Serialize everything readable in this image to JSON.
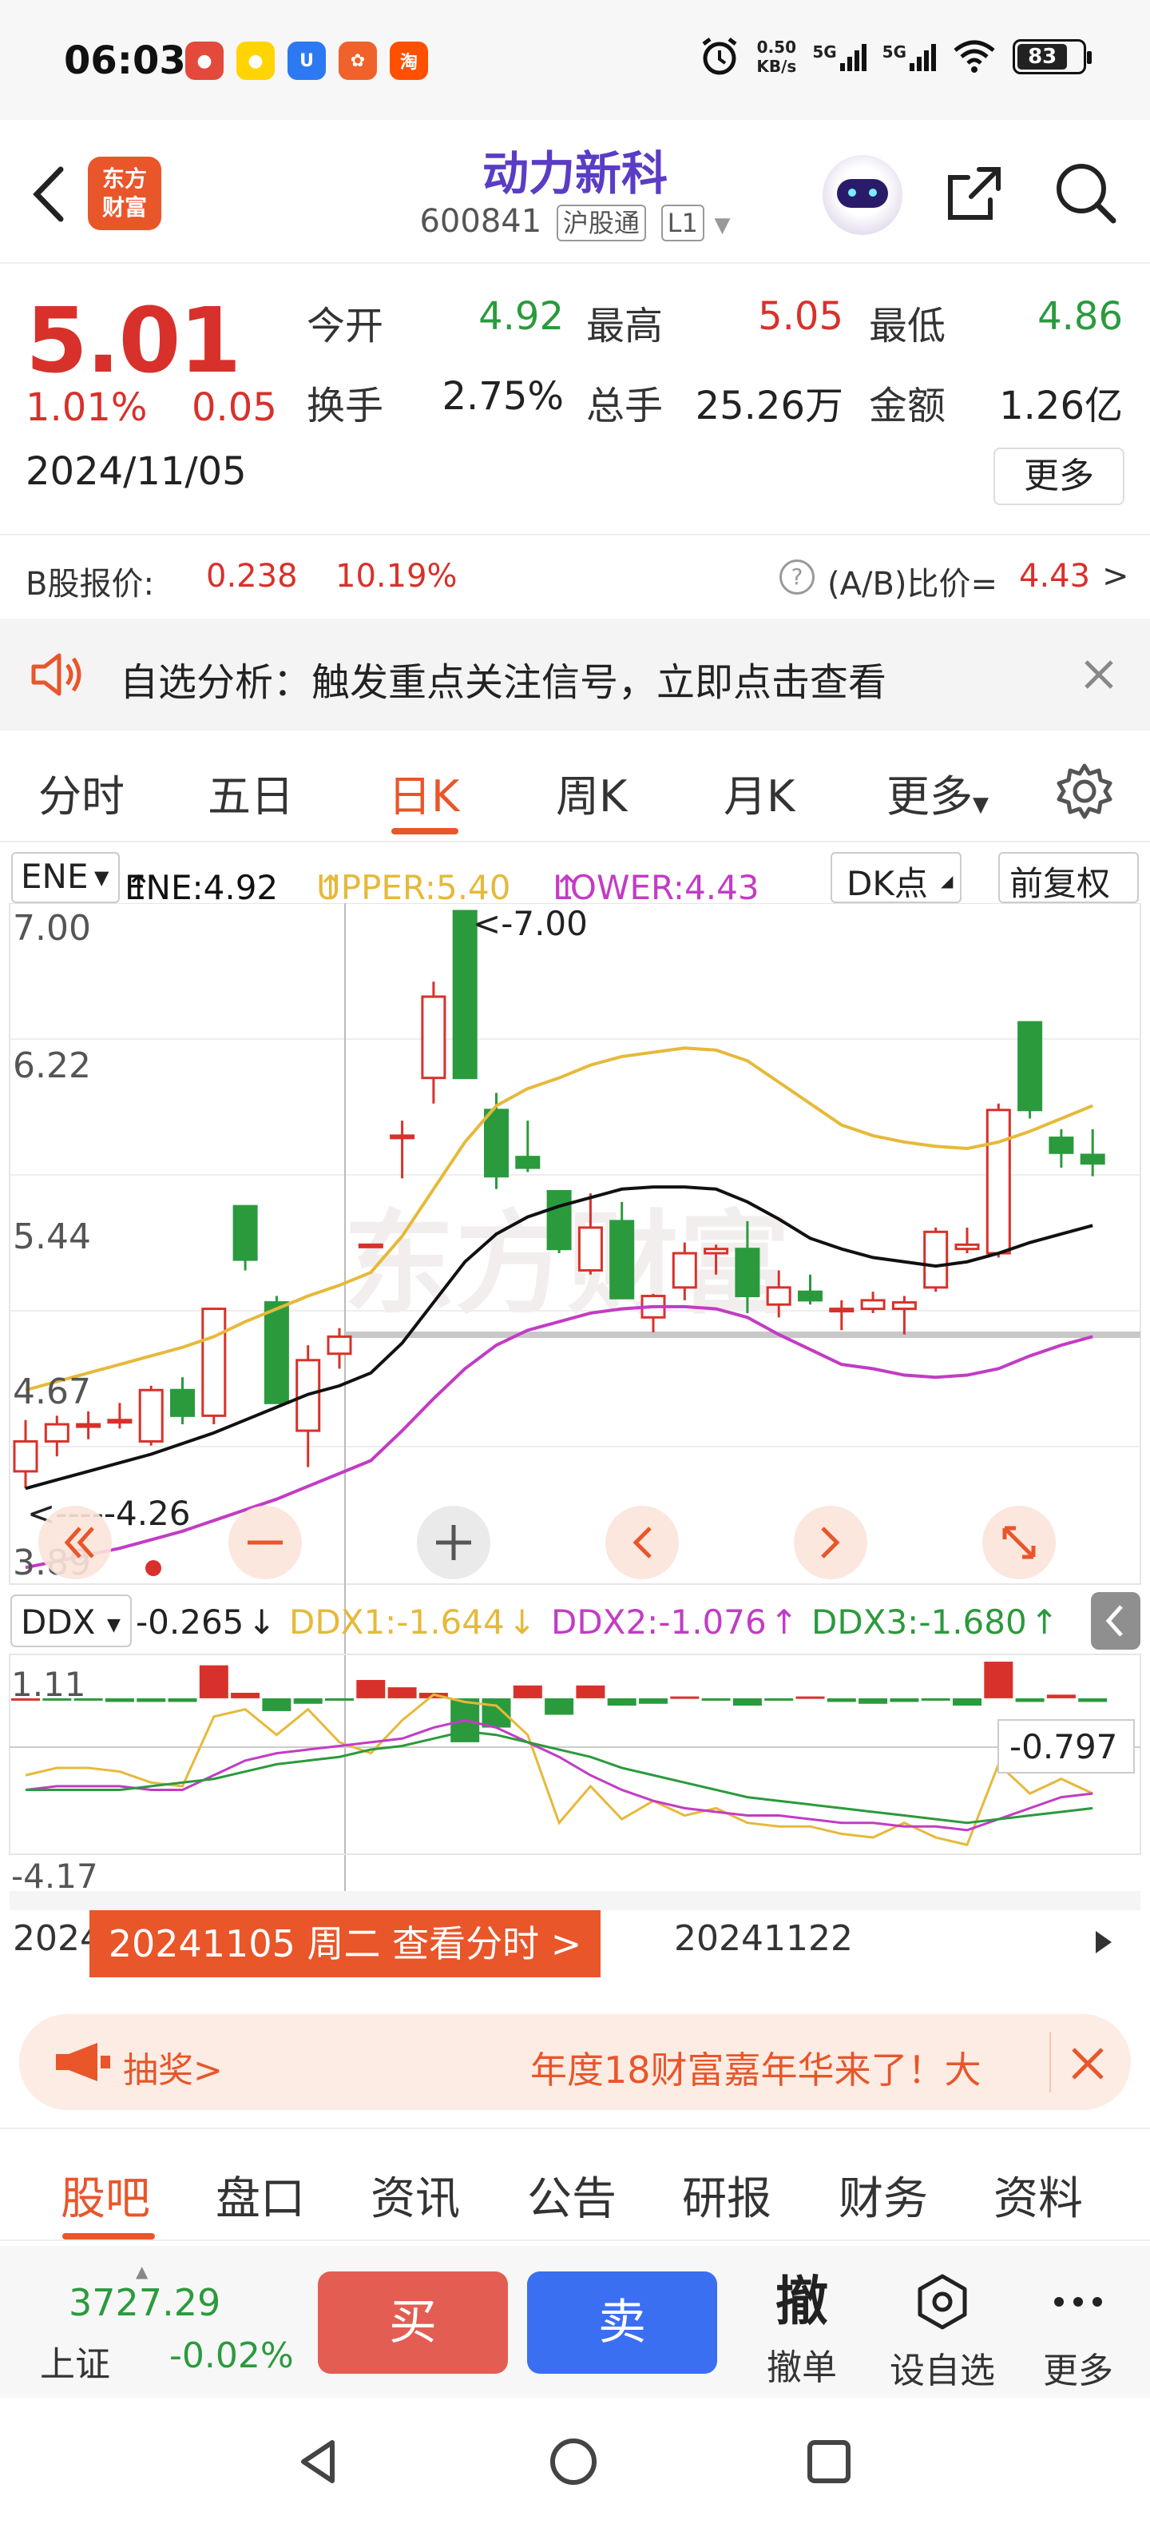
{
  "status_bar": {
    "time": "06:03",
    "app_icons": [
      "app-icon-1",
      "app-icon-2",
      "app-icon-3",
      "app-icon-4",
      "app-icon-5"
    ],
    "net_speed_value": "0.50",
    "net_speed_unit": "KB/s",
    "net_type_1": "5G",
    "net_type_2": "5G",
    "battery": "83"
  },
  "header": {
    "logo_line1": "东方",
    "logo_line2": "财富",
    "stock_name": "动力新科",
    "stock_code": "600841",
    "tag_connect": "沪股通",
    "tag_level": "L1"
  },
  "quote": {
    "price": "5.01",
    "change_pct": "1.01%",
    "change_val": "0.05",
    "date": "2024/11/05",
    "open_label": "今开",
    "open": "4.92",
    "high_label": "最高",
    "high": "5.05",
    "low_label": "最低",
    "low": "4.86",
    "turnover_label": "换手",
    "turnover": "2.75%",
    "volume_label": "总手",
    "volume": "25.26万",
    "amount_label": "金额",
    "amount": "1.26亿",
    "more_label": "更多"
  },
  "bshare": {
    "label": "B股报价:",
    "price": "0.238",
    "pct": "10.19%",
    "ratio_label": "(A/B)比价=",
    "ratio": "4.43",
    "arrow": ">"
  },
  "alert": {
    "text": "自选分析：触发重点关注信号，立即点击查看"
  },
  "chart_tabs": {
    "items": [
      "分时",
      "五日",
      "日K",
      "周K",
      "月K",
      "更多"
    ],
    "active": "日K"
  },
  "indicator": {
    "name": "ENE",
    "ene": "ENE:4.92",
    "ene_arrow": "↑",
    "upper": "UPPER:5.40",
    "upper_arrow": "↑",
    "lower": "LOWER:4.43",
    "lower_arrow": "↑",
    "dk_label": "DK点",
    "adjust_label": "前复权",
    "ddx_name": "DDX",
    "ddx": "-0.265",
    "ddx_arrow": "↓",
    "ddx1": "DDX1:-1.644",
    "ddx1_arrow": "↓",
    "ddx2": "DDX2:-1.076",
    "ddx2_arrow": "↑",
    "ddx3": "DDX3:-1.680",
    "ddx3_arrow": "↑"
  },
  "chart_labels": {
    "y_ticks": [
      "7.00",
      "6.22",
      "5.44",
      "4.67",
      "3.89"
    ],
    "max_marker": "<-7.00",
    "min_marker": "<-----4.26",
    "ddx_y_top": "1.11",
    "ddx_y_bottom": "-4.17",
    "ddx_current": "-0.797",
    "date_axis_left": "2024",
    "date_axis_mid": "20241122"
  },
  "chart_data": {
    "type": "candlestick",
    "ylim": [
      3.89,
      7.0
    ],
    "colors": {
      "up": "#d8312b",
      "down": "#2b9a3d",
      "upper": "#e6b93a",
      "mid": "#111111",
      "lower": "#c23cc4"
    },
    "candles": [
      {
        "o": 4.38,
        "h": 4.62,
        "l": 4.3,
        "c": 4.52
      },
      {
        "o": 4.52,
        "h": 4.64,
        "l": 4.45,
        "c": 4.6
      },
      {
        "o": 4.6,
        "h": 4.66,
        "l": 4.53,
        "c": 4.6
      },
      {
        "o": 4.62,
        "h": 4.7,
        "l": 4.58,
        "c": 4.62
      },
      {
        "o": 4.52,
        "h": 4.78,
        "l": 4.5,
        "c": 4.76
      },
      {
        "o": 4.76,
        "h": 4.82,
        "l": 4.6,
        "c": 4.64
      },
      {
        "o": 4.64,
        "h": 5.14,
        "l": 4.6,
        "c": 5.14
      },
      {
        "o": 5.62,
        "h": 5.62,
        "l": 5.32,
        "c": 5.37
      },
      {
        "o": 5.17,
        "h": 5.2,
        "l": 4.7,
        "c": 4.7
      },
      {
        "o": 4.57,
        "h": 4.97,
        "l": 4.4,
        "c": 4.9
      },
      {
        "o": 4.93,
        "h": 5.05,
        "l": 4.86,
        "c": 5.01
      },
      {
        "o": 5.44,
        "h": 5.44,
        "l": 5.44,
        "c": 5.44
      },
      {
        "o": 5.95,
        "h": 6.02,
        "l": 5.75,
        "c": 5.95
      },
      {
        "o": 6.22,
        "h": 6.67,
        "l": 6.1,
        "c": 6.6
      },
      {
        "o": 7.0,
        "h": 7.0,
        "l": 6.22,
        "c": 6.22
      },
      {
        "o": 6.07,
        "h": 6.15,
        "l": 5.7,
        "c": 5.76
      },
      {
        "o": 5.85,
        "h": 6.02,
        "l": 5.78,
        "c": 5.8
      },
      {
        "o": 5.69,
        "h": 5.69,
        "l": 5.4,
        "c": 5.42
      },
      {
        "o": 5.32,
        "h": 5.68,
        "l": 5.3,
        "c": 5.52
      },
      {
        "o": 5.55,
        "h": 5.64,
        "l": 5.19,
        "c": 5.19
      },
      {
        "o": 5.1,
        "h": 5.21,
        "l": 5.03,
        "c": 5.2
      },
      {
        "o": 5.24,
        "h": 5.45,
        "l": 5.18,
        "c": 5.4
      },
      {
        "o": 5.4,
        "h": 5.44,
        "l": 5.3,
        "c": 5.42
      },
      {
        "o": 5.42,
        "h": 5.55,
        "l": 5.12,
        "c": 5.2
      },
      {
        "o": 5.16,
        "h": 5.32,
        "l": 5.1,
        "c": 5.24
      },
      {
        "o": 5.22,
        "h": 5.3,
        "l": 5.16,
        "c": 5.18
      },
      {
        "o": 5.14,
        "h": 5.18,
        "l": 5.04,
        "c": 5.14
      },
      {
        "o": 5.14,
        "h": 5.22,
        "l": 5.12,
        "c": 5.18
      },
      {
        "o": 5.14,
        "h": 5.2,
        "l": 5.02,
        "c": 5.17
      },
      {
        "o": 5.24,
        "h": 5.52,
        "l": 5.22,
        "c": 5.5
      },
      {
        "o": 5.42,
        "h": 5.52,
        "l": 5.4,
        "c": 5.44
      },
      {
        "o": 5.4,
        "h": 6.1,
        "l": 5.38,
        "c": 6.07
      },
      {
        "o": 6.48,
        "h": 6.48,
        "l": 6.03,
        "c": 6.07
      },
      {
        "o": 5.94,
        "h": 5.98,
        "l": 5.8,
        "c": 5.87
      },
      {
        "o": 5.86,
        "h": 5.98,
        "l": 5.76,
        "c": 5.82
      }
    ],
    "upper": [
      4.76,
      4.8,
      4.84,
      4.88,
      4.92,
      4.96,
      5.01,
      5.08,
      5.14,
      5.2,
      5.25,
      5.31,
      5.48,
      5.7,
      5.92,
      6.09,
      6.17,
      6.22,
      6.28,
      6.32,
      6.34,
      6.36,
      6.35,
      6.3,
      6.2,
      6.1,
      6.0,
      5.95,
      5.92,
      5.9,
      5.89,
      5.92,
      5.97,
      6.03,
      6.09
    ],
    "mid": [
      4.3,
      4.34,
      4.38,
      4.42,
      4.46,
      4.51,
      4.56,
      4.62,
      4.68,
      4.74,
      4.78,
      4.84,
      4.98,
      5.17,
      5.36,
      5.49,
      5.57,
      5.62,
      5.66,
      5.7,
      5.71,
      5.71,
      5.7,
      5.64,
      5.56,
      5.47,
      5.42,
      5.38,
      5.36,
      5.34,
      5.36,
      5.4,
      5.45,
      5.49,
      5.53
    ],
    "lower": [
      3.93,
      3.96,
      3.99,
      4.02,
      4.06,
      4.1,
      4.15,
      4.2,
      4.25,
      4.31,
      4.37,
      4.43,
      4.57,
      4.72,
      4.86,
      4.97,
      5.04,
      5.08,
      5.12,
      5.14,
      5.15,
      5.15,
      5.14,
      5.1,
      5.02,
      4.95,
      4.88,
      4.86,
      4.83,
      4.82,
      4.83,
      4.86,
      4.92,
      4.97,
      5.01
    ],
    "ddx": {
      "ylim": [
        -4.17,
        1.11
      ],
      "colors": {
        "ddx1": "#e6b93a",
        "ddx2": "#c23cc4",
        "ddx3": "#2b9a3d",
        "pos": "#d8312b",
        "neg": "#2b9a3d"
      },
      "bars": [
        0.0,
        -0.05,
        -0.05,
        -0.1,
        -0.1,
        -0.1,
        0.9,
        0.15,
        -0.35,
        -0.15,
        -0.05,
        0.5,
        0.3,
        0.15,
        -1.2,
        -0.8,
        0.35,
        -0.45,
        0.35,
        -0.2,
        -0.15,
        0.05,
        -0.05,
        -0.2,
        -0.05,
        0.05,
        -0.1,
        -0.15,
        -0.1,
        -0.05,
        -0.2,
        1.0,
        -0.1,
        0.1,
        -0.1
      ],
      "ddx1": [
        -2.1,
        -1.9,
        -1.9,
        -2.0,
        -2.3,
        -2.4,
        -0.5,
        -0.3,
        -1.0,
        -0.3,
        -1.2,
        -1.5,
        -0.6,
        0.1,
        -0.1,
        -0.2,
        -1.0,
        -3.4,
        -2.4,
        -3.3,
        -2.8,
        -3.2,
        -3.0,
        -3.4,
        -3.5,
        -3.5,
        -3.7,
        -3.8,
        -3.4,
        -3.8,
        -4.0,
        -1.8,
        -2.6,
        -2.2,
        -2.6
      ],
      "ddx2": [
        -2.5,
        -2.4,
        -2.4,
        -2.4,
        -2.5,
        -2.5,
        -2.1,
        -1.7,
        -1.5,
        -1.4,
        -1.3,
        -1.2,
        -1.1,
        -0.8,
        -0.6,
        -0.8,
        -1.2,
        -1.6,
        -2.1,
        -2.5,
        -2.8,
        -3.0,
        -3.1,
        -3.2,
        -3.2,
        -3.3,
        -3.4,
        -3.4,
        -3.5,
        -3.5,
        -3.6,
        -3.3,
        -3.0,
        -2.7,
        -2.6
      ],
      "ddx3": [
        -2.5,
        -2.5,
        -2.5,
        -2.5,
        -2.4,
        -2.3,
        -2.2,
        -2.0,
        -1.8,
        -1.7,
        -1.6,
        -1.4,
        -1.3,
        -1.1,
        -0.9,
        -1.0,
        -1.2,
        -1.4,
        -1.6,
        -1.9,
        -2.1,
        -2.3,
        -2.5,
        -2.7,
        -2.8,
        -2.9,
        -3.0,
        -3.1,
        -3.2,
        -3.3,
        -3.4,
        -3.3,
        -3.2,
        -3.1,
        -3.0
      ]
    }
  },
  "date_pill": "20241105 周二 查看分时 >",
  "promo": {
    "left": "抽奖>",
    "right": "年度18财富嘉年华来了！大"
  },
  "content_tabs": {
    "items": [
      "股吧",
      "盘口",
      "资讯",
      "公告",
      "研报",
      "财务",
      "资料"
    ],
    "active": "股吧"
  },
  "tradebar": {
    "index_value": "3727.29",
    "index_name": "上证",
    "index_change": "-0.02%",
    "buy": "买",
    "sell": "卖",
    "cancel_glyph": "撤",
    "cancel_label": "撤单",
    "watch_label": "设自选",
    "more_label": "更多"
  }
}
